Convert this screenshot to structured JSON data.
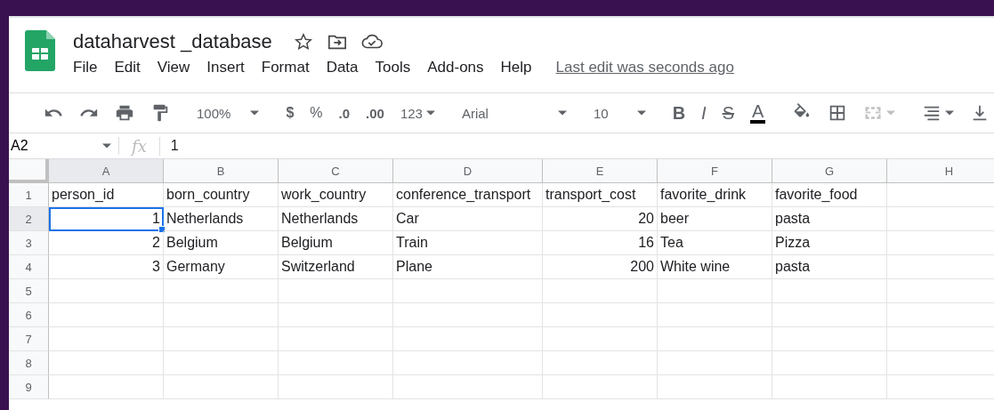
{
  "document": {
    "title": "dataharvest _database",
    "starred": false
  },
  "menu": [
    "File",
    "Edit",
    "View",
    "Insert",
    "Format",
    "Data",
    "Tools",
    "Add-ons",
    "Help"
  ],
  "last_edit": "Last edit was seconds ago",
  "toolbar": {
    "zoom": "100%",
    "currency": "$",
    "percent": "%",
    "decrease_decimals": ".0",
    "increase_decimals": ".00",
    "more_formats": "123",
    "font": "Arial",
    "font_size": "10",
    "bold": "B",
    "italic": "I",
    "strikethrough": "S",
    "text_color": "A",
    "merge_disabled": true
  },
  "formula_bar": {
    "cell_ref": "A2",
    "fx": "fx",
    "value": "1"
  },
  "columns": [
    {
      "letter": "A",
      "selected": true
    },
    {
      "letter": "B",
      "selected": false
    },
    {
      "letter": "C",
      "selected": false
    },
    {
      "letter": "D",
      "selected": false
    },
    {
      "letter": "E",
      "selected": false
    },
    {
      "letter": "F",
      "selected": false
    },
    {
      "letter": "G",
      "selected": false
    },
    {
      "letter": "H",
      "selected": false
    }
  ],
  "rows": [
    {
      "number": "1",
      "selected": false,
      "cells": [
        {
          "text": "person_id",
          "kind": "text",
          "selected": false
        },
        {
          "text": "born_country",
          "kind": "text",
          "selected": false
        },
        {
          "text": "work_country",
          "kind": "text",
          "selected": false
        },
        {
          "text": "conference_transport",
          "kind": "text",
          "selected": false
        },
        {
          "text": "transport_cost",
          "kind": "text",
          "selected": false
        },
        {
          "text": "favorite_drink",
          "kind": "text",
          "selected": false
        },
        {
          "text": "favorite_food",
          "kind": "text",
          "selected": false
        }
      ]
    },
    {
      "number": "2",
      "selected": true,
      "cells": [
        {
          "text": "1",
          "kind": "number",
          "selected": true
        },
        {
          "text": "Netherlands",
          "kind": "text",
          "selected": false
        },
        {
          "text": "Netherlands",
          "kind": "text",
          "selected": false
        },
        {
          "text": "Car",
          "kind": "text",
          "selected": false
        },
        {
          "text": "20",
          "kind": "number",
          "selected": false
        },
        {
          "text": "beer",
          "kind": "text",
          "selected": false
        },
        {
          "text": "pasta",
          "kind": "text",
          "selected": false
        }
      ]
    },
    {
      "number": "3",
      "selected": false,
      "cells": [
        {
          "text": "2",
          "kind": "number",
          "selected": false
        },
        {
          "text": "Belgium",
          "kind": "text",
          "selected": false
        },
        {
          "text": "Belgium",
          "kind": "text",
          "selected": false
        },
        {
          "text": "Train",
          "kind": "text",
          "selected": false
        },
        {
          "text": "16",
          "kind": "number",
          "selected": false
        },
        {
          "text": "Tea",
          "kind": "text",
          "selected": false
        },
        {
          "text": "Pizza",
          "kind": "text",
          "selected": false
        }
      ]
    },
    {
      "number": "4",
      "selected": false,
      "cells": [
        {
          "text": "3",
          "kind": "number",
          "selected": false
        },
        {
          "text": "Germany",
          "kind": "text",
          "selected": false
        },
        {
          "text": "Switzerland",
          "kind": "text",
          "selected": false
        },
        {
          "text": "Plane",
          "kind": "text",
          "selected": false
        },
        {
          "text": "200",
          "kind": "number",
          "selected": false
        },
        {
          "text": "White wine",
          "kind": "text",
          "selected": false
        },
        {
          "text": "pasta",
          "kind": "text",
          "selected": false
        }
      ]
    },
    {
      "number": "5",
      "selected": false
    },
    {
      "number": "6",
      "selected": false
    },
    {
      "number": "7",
      "selected": false
    },
    {
      "number": "8",
      "selected": false
    },
    {
      "number": "9",
      "selected": false
    }
  ]
}
